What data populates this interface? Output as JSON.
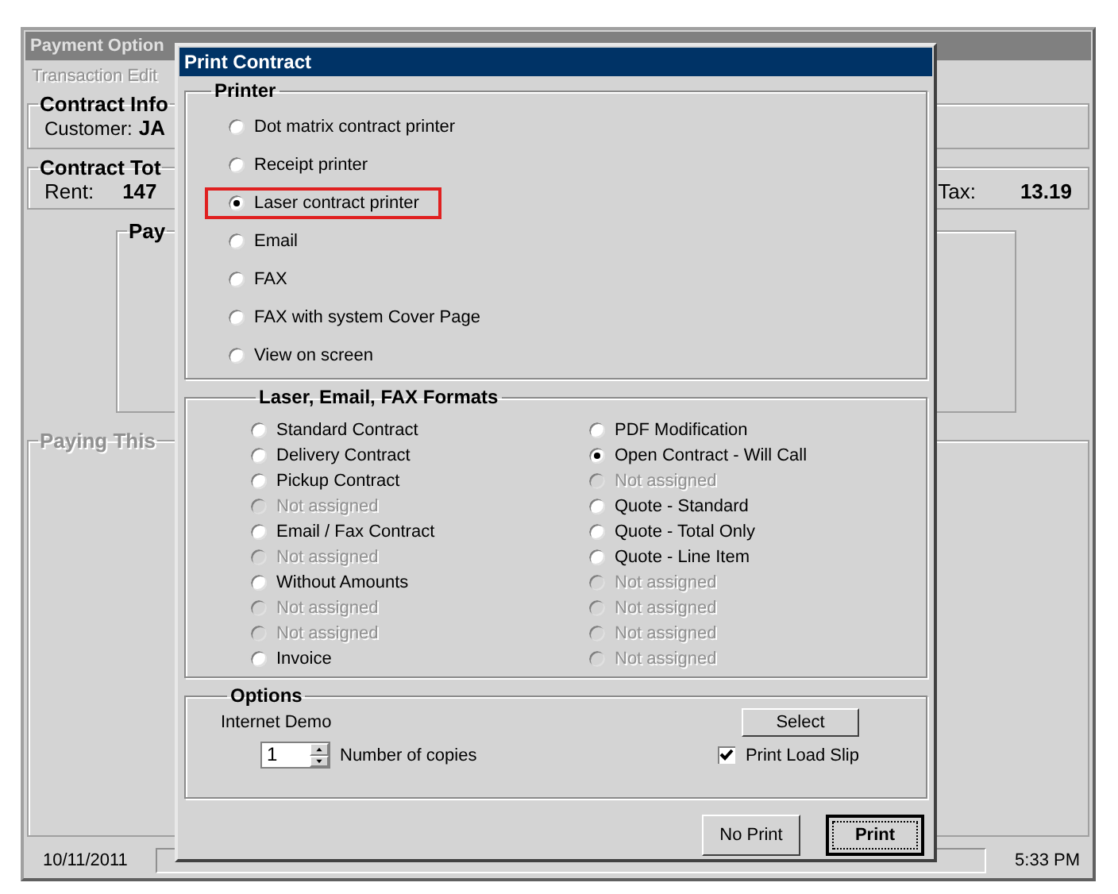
{
  "background_window": {
    "title": "Payment Option",
    "menu": [
      {
        "label": "Transaction Edit",
        "disabled": true
      }
    ],
    "contract_info": {
      "title": "Contract Info",
      "customer_label": "Customer:",
      "customer_value": "JA"
    },
    "contract_totals": {
      "title": "Contract Tot",
      "rent_label": "Rent:",
      "rent_value": "147",
      "tax_label": "Tax:",
      "tax_value": "13.19"
    },
    "payment_group": {
      "title": "Pay"
    },
    "paying_group": {
      "title": "Paying This",
      "disabled": true
    }
  },
  "status_bar": {
    "date": "10/11/2011",
    "time": "5:33 PM"
  },
  "dialog": {
    "title": "Print Contract",
    "printer": {
      "title": "Printer",
      "options": [
        {
          "label": "Dot matrix contract printer",
          "selected": false,
          "highlighted": false
        },
        {
          "label": "Receipt printer",
          "selected": false,
          "highlighted": false
        },
        {
          "label": "Laser contract printer",
          "selected": true,
          "highlighted": true
        },
        {
          "label": "Email",
          "selected": false,
          "highlighted": false
        },
        {
          "label": "FAX",
          "selected": false,
          "highlighted": false
        },
        {
          "label": "FAX with system Cover Page",
          "selected": false,
          "highlighted": false
        },
        {
          "label": "View on screen",
          "selected": false,
          "highlighted": false
        }
      ]
    },
    "formats": {
      "title": "Laser, Email, FAX Formats",
      "columns": [
        [
          {
            "label": "Standard Contract",
            "selected": false,
            "disabled": false
          },
          {
            "label": "Delivery Contract",
            "selected": false,
            "disabled": false
          },
          {
            "label": "Pickup Contract",
            "selected": false,
            "disabled": false
          },
          {
            "label": "Not assigned",
            "selected": false,
            "disabled": true
          },
          {
            "label": "Email / Fax Contract",
            "selected": false,
            "disabled": false
          },
          {
            "label": "Not assigned",
            "selected": false,
            "disabled": true
          },
          {
            "label": "Without Amounts",
            "selected": false,
            "disabled": false
          },
          {
            "label": "Not assigned",
            "selected": false,
            "disabled": true
          },
          {
            "label": "Not assigned",
            "selected": false,
            "disabled": true
          },
          {
            "label": "Invoice",
            "selected": false,
            "disabled": false
          }
        ],
        [
          {
            "label": "PDF Modification",
            "selected": false,
            "disabled": false
          },
          {
            "label": "Open Contract - Will Call",
            "selected": true,
            "disabled": false
          },
          {
            "label": "Not assigned",
            "selected": false,
            "disabled": true
          },
          {
            "label": "Quote - Standard",
            "selected": false,
            "disabled": false
          },
          {
            "label": "Quote - Total Only",
            "selected": false,
            "disabled": false
          },
          {
            "label": "Quote - Line Item",
            "selected": false,
            "disabled": false
          },
          {
            "label": "Not assigned",
            "selected": false,
            "disabled": true
          },
          {
            "label": "Not assigned",
            "selected": false,
            "disabled": true
          },
          {
            "label": "Not assigned",
            "selected": false,
            "disabled": true
          },
          {
            "label": "Not assigned",
            "selected": false,
            "disabled": true
          }
        ]
      ]
    },
    "options": {
      "title": "Options",
      "printer_name": "Internet Demo",
      "select_button": "Select",
      "copies": "1",
      "copies_label": "Number of copies",
      "load_slip": {
        "label": "Print Load Slip",
        "checked": true
      }
    },
    "buttons": [
      {
        "label": "No Print",
        "default": false
      },
      {
        "label": "Print",
        "default": true
      }
    ]
  }
}
